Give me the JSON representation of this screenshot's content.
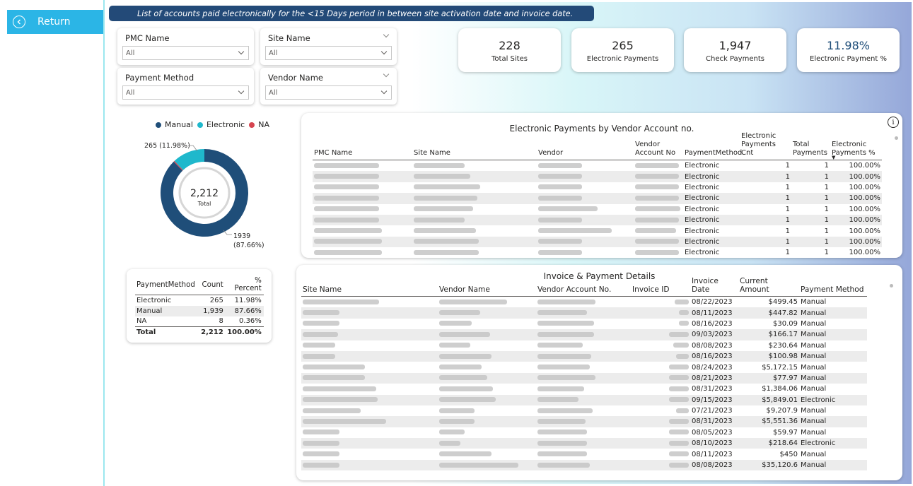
{
  "nav": {
    "return_label": "Return"
  },
  "banner": "List of accounts paid electronically for the <15 Days period in between site activation date and invoice date.",
  "filters": [
    {
      "title": "PMC Name",
      "value": "All"
    },
    {
      "title": "Site Name",
      "value": "All"
    },
    {
      "title": "Payment Method",
      "value": "All"
    },
    {
      "title": "Vendor Name",
      "value": "All"
    }
  ],
  "kpis": [
    {
      "value": "228",
      "caption": "Total Sites"
    },
    {
      "value": "265",
      "caption": "Electronic Payments"
    },
    {
      "value": "1,947",
      "caption": "Check Payments"
    },
    {
      "value": "11.98%",
      "caption": "Electronic Payment %"
    }
  ],
  "donut": {
    "legend": [
      {
        "label": "Manual",
        "color": "#1f4e79"
      },
      {
        "label": "Electronic",
        "color": "#1fb8cc"
      },
      {
        "label": "NA",
        "color": "#d64550"
      }
    ],
    "center_value": "2,212",
    "center_label": "Total",
    "label_electronic": "265 (11.98%)",
    "label_manual_value": "1939",
    "label_manual_pct": "(87.66%)"
  },
  "chart_data": {
    "type": "pie",
    "categories": [
      "Manual",
      "Electronic",
      "NA"
    ],
    "values": [
      1939,
      265,
      8
    ]
  },
  "summary": {
    "headers": [
      "PaymentMethod",
      "Count",
      "% Percent"
    ],
    "rows": [
      [
        "Electronic",
        "265",
        "11.98%"
      ],
      [
        "Manual",
        "1,939",
        "87.66%"
      ],
      [
        "NA",
        "8",
        "0.36%"
      ]
    ],
    "total": [
      "Total",
      "2,212",
      "100.00%"
    ]
  },
  "vendor_table": {
    "title": "Electronic Payments by Vendor Account no.",
    "headers": [
      "PMC Name",
      "Site Name",
      "Vendor",
      "Vendor Account No",
      "PaymentMethod",
      "Electronic Payments Cnt",
      "Total Payments",
      "Electronic Payments %"
    ],
    "rows": [
      [
        "Electronic",
        "1",
        "1",
        "100.00%"
      ],
      [
        "Electronic",
        "1",
        "1",
        "100.00%"
      ],
      [
        "Electronic",
        "1",
        "1",
        "100.00%"
      ],
      [
        "Electronic",
        "1",
        "1",
        "100.00%"
      ],
      [
        "Electronic",
        "1",
        "1",
        "100.00%"
      ],
      [
        "Electronic",
        "1",
        "1",
        "100.00%"
      ],
      [
        "Electronic",
        "1",
        "1",
        "100.00%"
      ],
      [
        "Electronic",
        "1",
        "1",
        "100.00%"
      ],
      [
        "Electronic",
        "1",
        "1",
        "100.00%"
      ]
    ]
  },
  "invoice_table": {
    "title": "Invoice & Payment Details",
    "headers": [
      "Site Name",
      "Vendor Name",
      "Vendor Account No.",
      "Invoice ID",
      "Invoice Date",
      "Current Amount",
      "Payment Method"
    ],
    "rows": [
      [
        "08/22/2023",
        "$499.45",
        "Manual"
      ],
      [
        "08/11/2023",
        "$447.82",
        "Manual"
      ],
      [
        "08/16/2023",
        "$30.09",
        "Manual"
      ],
      [
        "09/03/2023",
        "$166.17",
        "Manual"
      ],
      [
        "08/08/2023",
        "$230.64",
        "Manual"
      ],
      [
        "08/16/2023",
        "$100.98",
        "Manual"
      ],
      [
        "08/24/2023",
        "$5,172.15",
        "Manual"
      ],
      [
        "08/21/2023",
        "$77.97",
        "Manual"
      ],
      [
        "08/31/2023",
        "$1,384.06",
        "Manual"
      ],
      [
        "09/15/2023",
        "$5,849.01",
        "Electronic"
      ],
      [
        "07/21/2023",
        "$9,207.9",
        "Manual"
      ],
      [
        "08/31/2023",
        "$5,551.36",
        "Manual"
      ],
      [
        "08/05/2023",
        "$59.97",
        "Manual"
      ],
      [
        "08/10/2023",
        "$218.64",
        "Electronic"
      ],
      [
        "08/11/2023",
        "$450",
        "Manual"
      ],
      [
        "08/08/2023",
        "$35,120.6",
        "Manual"
      ]
    ]
  }
}
